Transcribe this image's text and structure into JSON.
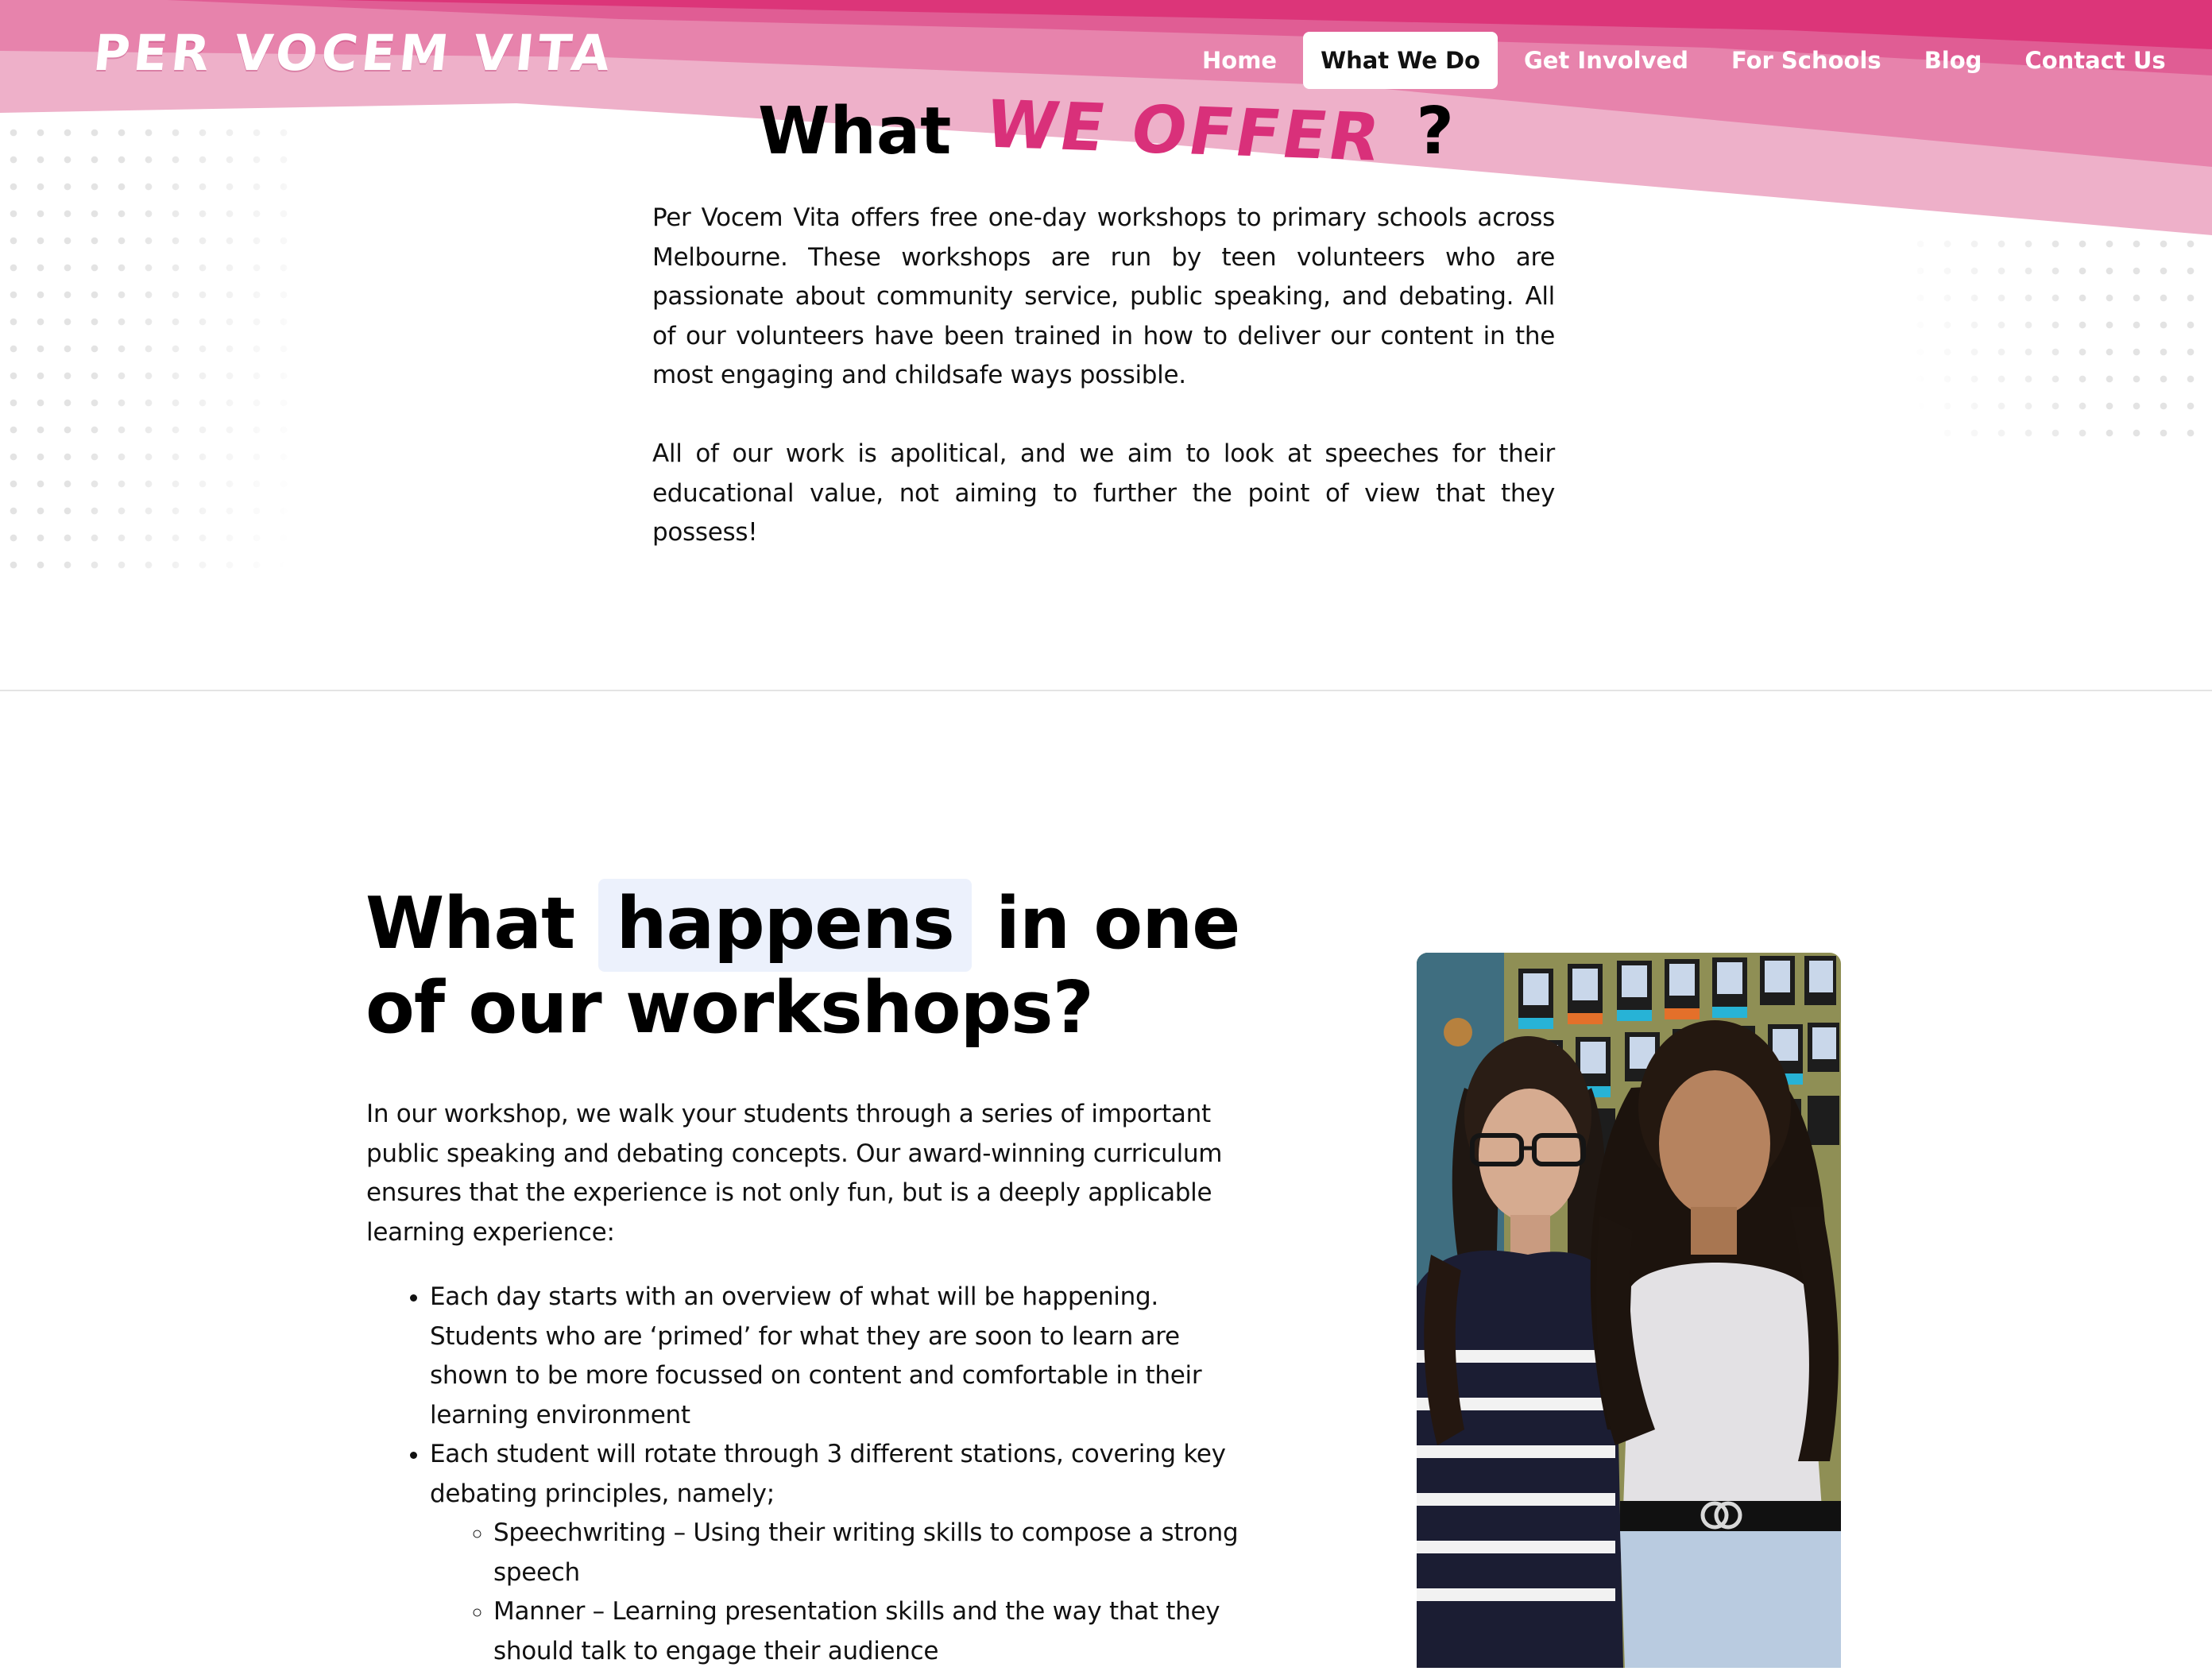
{
  "header": {
    "logo": "PER VOCEM VITA",
    "nav": [
      {
        "label": "Home",
        "active": false
      },
      {
        "label": "What We Do",
        "active": true
      },
      {
        "label": "Get Involved",
        "active": false
      },
      {
        "label": "For Schools",
        "active": false
      },
      {
        "label": "Blog",
        "active": false
      },
      {
        "label": "Contact Us",
        "active": false
      }
    ]
  },
  "offer": {
    "title_prefix": "What",
    "title_accent": "WE OFFER",
    "title_suffix": "?",
    "paragraphs": [
      "Per Vocem Vita offers free one-day workshops to primary schools across Melbourne. These workshops are run by teen volunteers who are passionate about community service, public speaking, and debating. All of our volunteers have been trained in how to deliver our content in the most engaging and childsafe ways possible.",
      "All of our work is apolitical, and we aim to look at speeches for their educational value, not aiming to further the point of view that they possess!"
    ]
  },
  "workshop": {
    "title_prefix": "What",
    "title_highlight": "happens",
    "title_suffix": "in one of our workshops?",
    "intro": "In our workshop, we walk your students through a series of important public speaking and debating concepts. Our award-winning curriculum ensures that the experience is not only fun, but is a deeply applicable learning experience:",
    "bullets": [
      "Each day starts with an overview of what will be happening. Students who are ‘primed’ for what they are soon to learn are shown to be more focussed on content and comfortable in their learning environment",
      "Each student will rotate through 3 different stations, covering key debating principles, namely;"
    ],
    "sub_bullets": [
      "Speechwriting – Using their writing skills to compose a strong speech",
      "Manner – Learning presentation skills and the way that they should talk to engage their audience"
    ]
  },
  "colors": {
    "brand_pink": "#d9307a",
    "header_pink_dark": "#dc3579",
    "header_pink_mid": "#e56a9c",
    "header_pink_light": "#eeb0c9",
    "highlight_bg": "#ecf1fc"
  }
}
